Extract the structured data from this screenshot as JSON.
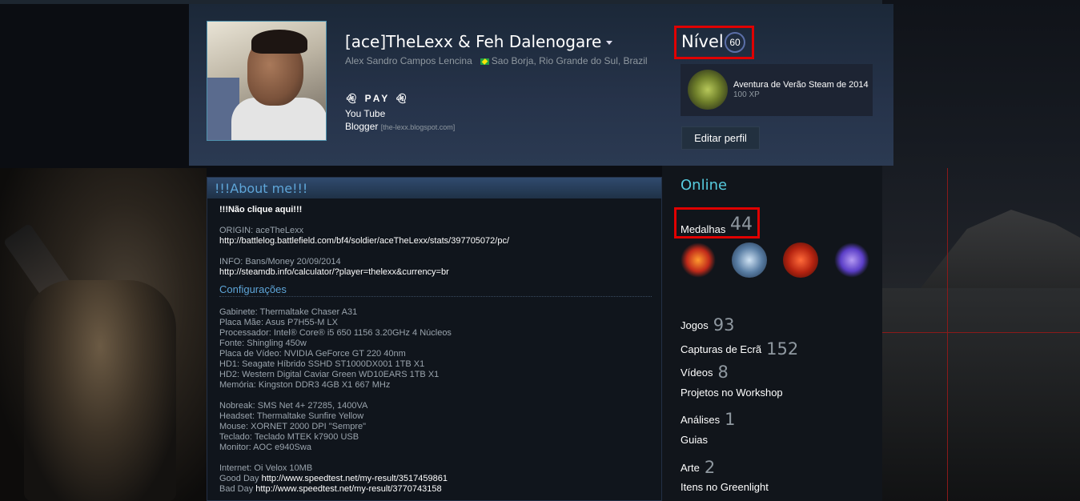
{
  "profile": {
    "persona_name": "[ace]TheLexx & Feh Dalenogare",
    "real_name": "Alex Sandro Campos Lencina",
    "location": "Sao Borja, Rio Grande do Sul, Brazil",
    "summary_pay": "PAY",
    "summary_youtube": "You Tube",
    "summary_blogger": "Blogger",
    "summary_blog_link": "[the-lexx.blogspot.com]"
  },
  "level": {
    "label": "Nível",
    "value": "60"
  },
  "featured_badge": {
    "title": "Aventura de Verão Steam de 2014",
    "xp": "100 XP"
  },
  "edit_profile_label": "Editar perfil",
  "about": {
    "title": "!!!About me!!!",
    "lines": {
      "dont_click": "!!!Não clique aqui!!!",
      "origin": "ORIGIN: aceTheLexx",
      "origin_link": "http://battlelog.battlefield.com/bf4/soldier/aceTheLexx/stats/397705072/pc/",
      "info": "INFO: Bans/Money 20/09/2014",
      "info_link": "http://steamdb.info/calculator/?player=thelexx&currency=br",
      "config_heading": "Configurações",
      "gabinete": "Gabinete: Thermaltake Chaser A31",
      "placa_mae": "Placa Mãe: Asus P7H55-M LX",
      "processador": "Processador: Intel® Core® i5 650 1156 3.20GHz 4 Núcleos",
      "fonte": "Fonte: Shingling 450w",
      "placa_video": "Placa de Vídeo: NVIDIA GeForce GT 220 40nm",
      "hd1": "HD1: Seagate Híbrido SSHD ST1000DX001 1TB X1",
      "hd2": "HD2: Western Digital Caviar Green WD10EARS 1TB X1",
      "memoria": "Memória: Kingston DDR3 4GB X1 667 MHz",
      "nobreak": "Nobreak: SMS Net 4+ 27285, 1400VA",
      "headset": "Headset: Thermaltake Sunfire Yellow",
      "mouse": "Mouse: XORNET 2000 DPI \"Sempre\"",
      "teclado": "Teclado: Teclado MTEK k7900 USB",
      "monitor": "Monitor: AOC e940Swa",
      "internet": "Internet: Oi Velox 10MB",
      "good_day_label": "Good Day ",
      "good_day_link": "http://www.speedtest.net/my-result/3517459861",
      "bad_day_label": "Bad Day ",
      "bad_day_link": "http://www.speedtest.net/my-result/3770743158"
    }
  },
  "sidebar": {
    "status": "Online",
    "badges_label": "Medalhas",
    "badges_count": "44",
    "medal_icons": [
      "flame-wing-medal-icon",
      "police-officer-medal-icon",
      "dota-medal-icon",
      "purple-feather-medal-icon"
    ],
    "stats": [
      {
        "label": "Jogos",
        "count": "93"
      },
      {
        "label": "Capturas de Ecrã",
        "count": "152"
      },
      {
        "label": "Vídeos",
        "count": "8"
      },
      {
        "label": "Projetos no Workshop",
        "count": ""
      },
      {
        "label": "Análises",
        "count": "1"
      },
      {
        "label": "Guias",
        "count": ""
      },
      {
        "label": "Arte",
        "count": "2"
      },
      {
        "label": "Itens no Greenlight",
        "count": ""
      }
    ]
  },
  "colors": {
    "accent_blue": "#57cbde",
    "highlight_red": "#e00000",
    "header_bg": "#26334a"
  }
}
